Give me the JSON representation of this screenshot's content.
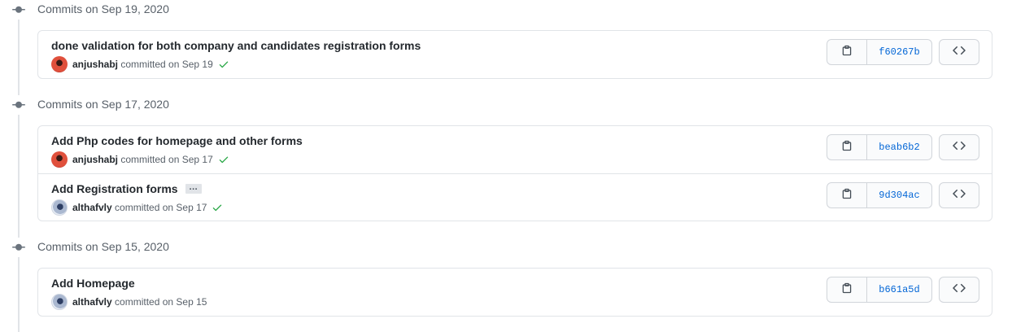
{
  "groups": [
    {
      "title": "Commits on Sep 19, 2020",
      "commits": [
        {
          "message": "done validation for both company and candidates registration forms",
          "author": "anjushabj",
          "committed_text": "committed on Sep 19",
          "sha": "f60267b",
          "verified": true,
          "avatar": "red",
          "has_ellipsis": false
        }
      ]
    },
    {
      "title": "Commits on Sep 17, 2020",
      "commits": [
        {
          "message": "Add Php codes for homepage and other forms",
          "author": "anjushabj",
          "committed_text": "committed on Sep 17",
          "sha": "beab6b2",
          "verified": true,
          "avatar": "red",
          "has_ellipsis": false
        },
        {
          "message": "Add Registration forms",
          "author": "althafvly",
          "committed_text": "committed on Sep 17",
          "sha": "9d304ac",
          "verified": true,
          "avatar": "blue",
          "has_ellipsis": true,
          "ellipsis_label": "…"
        }
      ]
    },
    {
      "title": "Commits on Sep 15, 2020",
      "commits": [
        {
          "message": "Add Homepage",
          "author": "althafvly",
          "committed_text": "committed on Sep 15",
          "sha": "b661a5d",
          "verified": false,
          "avatar": "blue",
          "has_ellipsis": false
        }
      ]
    }
  ],
  "icons": {
    "commit_node": "git-commit-icon",
    "copy": "clipboard-icon",
    "browse": "code-icon",
    "status": "check-icon"
  },
  "colors": {
    "link": "#0366d6",
    "success": "#28a745",
    "muted": "#586069",
    "border": "#e1e4e8"
  }
}
